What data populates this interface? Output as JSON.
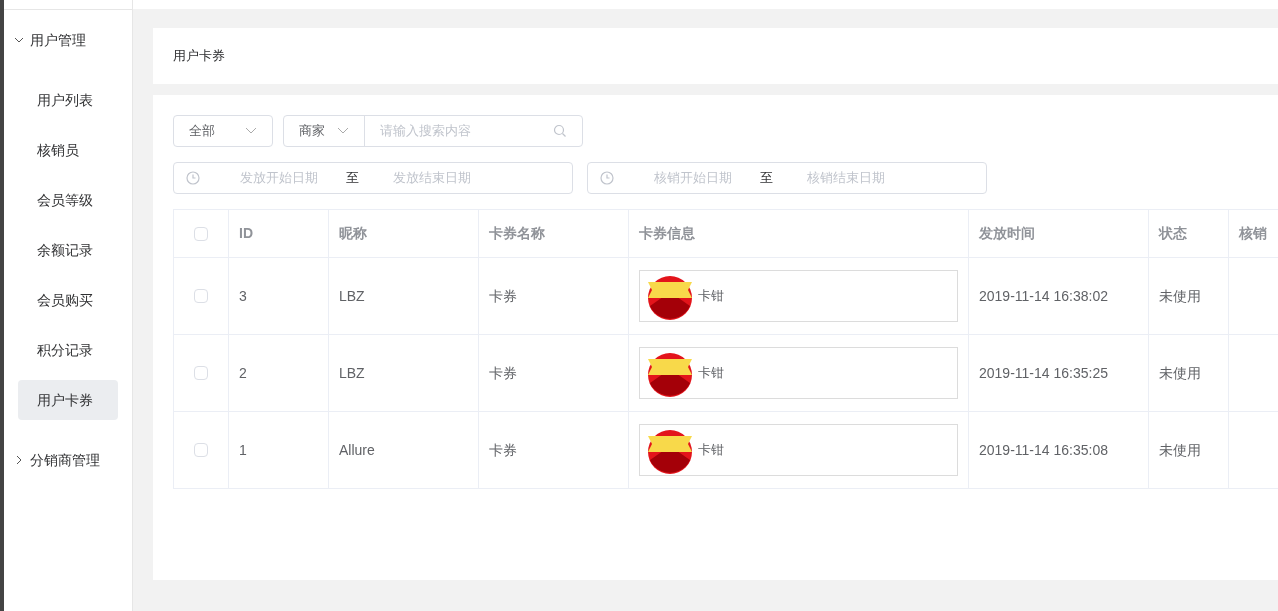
{
  "sidebar": {
    "groups": [
      {
        "label": "用户管理",
        "expanded": true,
        "items": [
          {
            "label": "用户列表",
            "selected": false
          },
          {
            "label": "核销员",
            "selected": false
          },
          {
            "label": "会员等级",
            "selected": false
          },
          {
            "label": "余额记录",
            "selected": false
          },
          {
            "label": "会员购买",
            "selected": false
          },
          {
            "label": "积分记录",
            "selected": false
          },
          {
            "label": "用户卡券",
            "selected": true
          }
        ]
      },
      {
        "label": "分销商管理",
        "expanded": false
      }
    ]
  },
  "page_title": "用户卡券",
  "filters": {
    "status_select": "全部",
    "search_type": "商家",
    "search_placeholder": "请输入搜索内容",
    "issue_range": {
      "start_placeholder": "发放开始日期",
      "separator": "至",
      "end_placeholder": "发放结束日期"
    },
    "redeem_range": {
      "start_placeholder": "核销开始日期",
      "separator": "至",
      "end_placeholder": "核销结束日期"
    }
  },
  "table": {
    "select_all_checked": false,
    "columns": [
      "ID",
      "昵称",
      "卡券名称",
      "卡券信息",
      "发放时间",
      "状态",
      "核销"
    ],
    "rows": [
      {
        "checked": false,
        "id": "3",
        "nickname": "LBZ",
        "coupon_name": "卡券",
        "coupon_info": "卡钳",
        "issued": "2019-11-14 16:38:02",
        "status": "未使用"
      },
      {
        "checked": false,
        "id": "2",
        "nickname": "LBZ",
        "coupon_name": "卡券",
        "coupon_info": "卡钳",
        "issued": "2019-11-14 16:35:25",
        "status": "未使用"
      },
      {
        "checked": false,
        "id": "1",
        "nickname": "Allure",
        "coupon_name": "卡券",
        "coupon_info": "卡钳",
        "issued": "2019-11-14 16:35:08",
        "status": "未使用"
      }
    ]
  }
}
